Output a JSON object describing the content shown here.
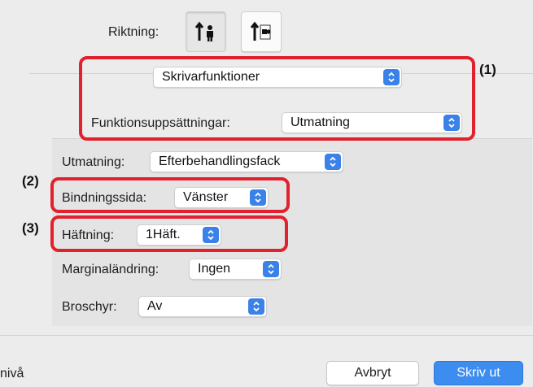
{
  "orientation": {
    "label": "Riktning:",
    "options": [
      {
        "name": "portrait",
        "selected": true
      },
      {
        "name": "landscape",
        "selected": false
      }
    ]
  },
  "panel_menu": {
    "value": "Skrivarfunktioner"
  },
  "feature_sets": {
    "label": "Funktionsuppsättningar:",
    "value": "Utmatning"
  },
  "output": {
    "label": "Utmatning:",
    "value": "Efterbehandlingsfack"
  },
  "binding_edge": {
    "label": "Bindningssida:",
    "value": "Vänster"
  },
  "stapling": {
    "label": "Häftning:",
    "value": "1Häft."
  },
  "margin_shift": {
    "label": "Marginaländring:",
    "value": "Ingen"
  },
  "booklet": {
    "label": "Broschyr:",
    "value": "Av"
  },
  "callouts": [
    "(1)",
    "(2)",
    "(3)"
  ],
  "footer": {
    "left_text": "nivå",
    "cancel_label": "Avbryt",
    "print_label": "Skriv ut"
  },
  "colors": {
    "accent": "#3b82e8",
    "callout": "#e1222e",
    "primary_button": "#3d8df0"
  }
}
